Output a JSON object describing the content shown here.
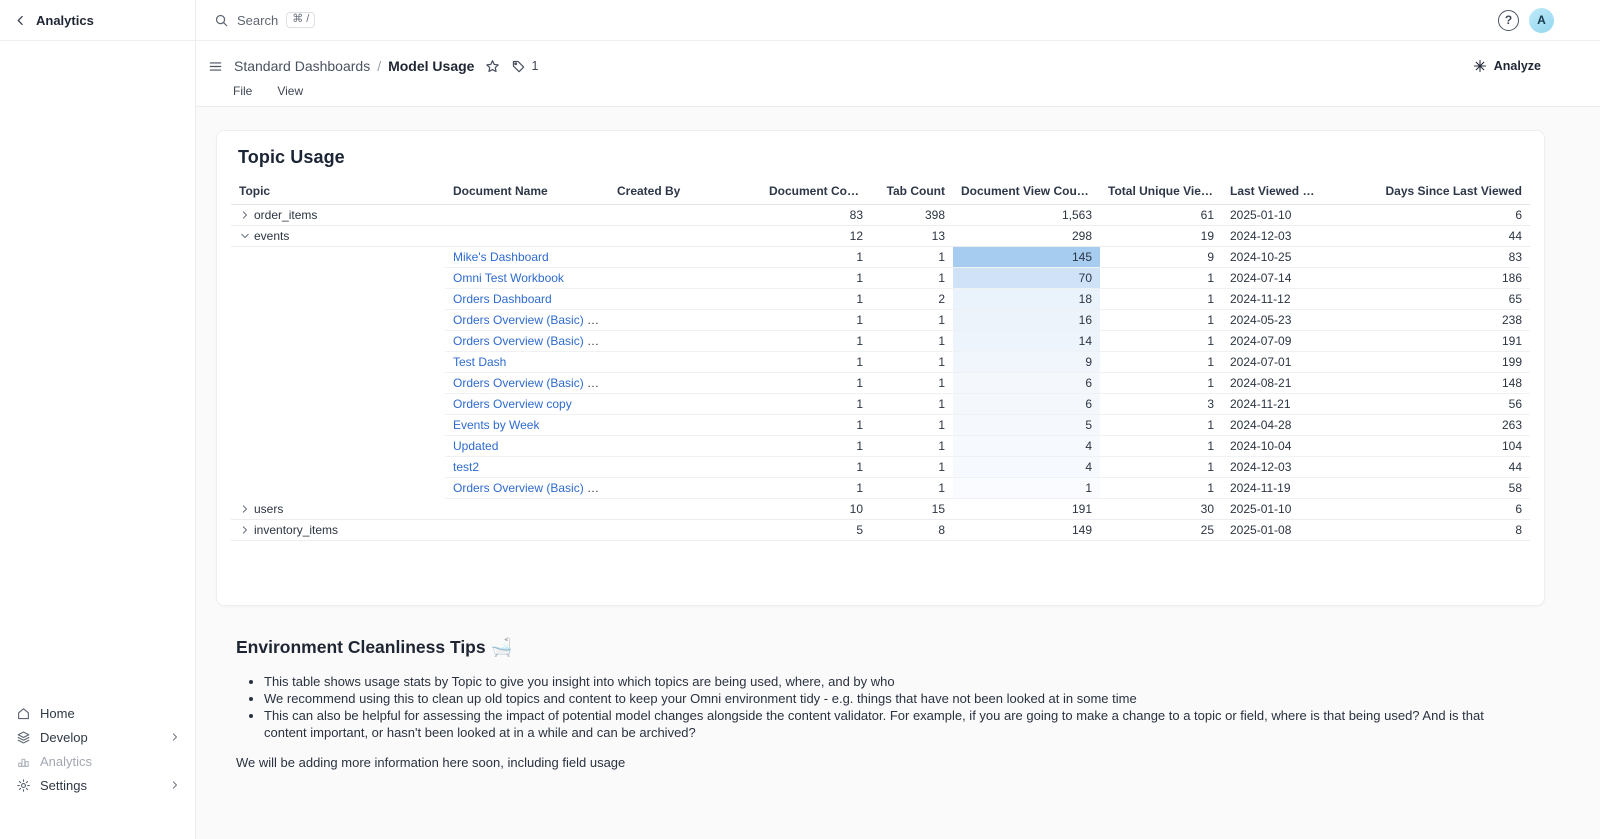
{
  "sidebar": {
    "title": "Analytics",
    "nav": [
      {
        "label": "Home",
        "icon": "home-icon",
        "chevron": false,
        "muted": false
      },
      {
        "label": "Develop",
        "icon": "layers-icon",
        "chevron": true,
        "muted": false
      },
      {
        "label": "Analytics",
        "icon": "bar-chart-icon",
        "chevron": false,
        "muted": true
      },
      {
        "label": "Settings",
        "icon": "gear-icon",
        "chevron": true,
        "muted": false
      }
    ]
  },
  "topbar": {
    "search_label": "Search",
    "search_shortcut": "⌘ /",
    "avatar_initial": "A",
    "help_glyph": "?"
  },
  "doc_header": {
    "breadcrumb_parent": "Standard Dashboards",
    "breadcrumb_separator": "/",
    "breadcrumb_current": "Model Usage",
    "tag_count": "1",
    "menus": [
      "File",
      "View"
    ],
    "analyze_label": "Analyze"
  },
  "table_card": {
    "title": "Topic Usage",
    "headers": [
      {
        "label": "Topic",
        "align": "left"
      },
      {
        "label": "Document Name",
        "align": "left"
      },
      {
        "label": "Created By",
        "align": "left"
      },
      {
        "label": "Document Count",
        "align": "right"
      },
      {
        "label": "Tab Count",
        "align": "right"
      },
      {
        "label": "Document View Count",
        "align": "right",
        "sort": "↓"
      },
      {
        "label": "Total Unique Viewers",
        "align": "right"
      },
      {
        "label": "Last Viewed Date",
        "align": "left"
      },
      {
        "label": "Days Since Last Viewed",
        "align": "right"
      }
    ],
    "rows": [
      {
        "type": "topic",
        "expanded": false,
        "topic": "order_items",
        "doc": "",
        "created_by": "",
        "document_count": "83",
        "tab_count": "398",
        "view_count": "1,563",
        "unique_viewers": "61",
        "last_viewed": "2025-01-10",
        "days": "6",
        "heat": ""
      },
      {
        "type": "topic",
        "expanded": true,
        "topic": "events",
        "doc": "",
        "created_by": "",
        "document_count": "12",
        "tab_count": "13",
        "view_count": "298",
        "unique_viewers": "19",
        "last_viewed": "2024-12-03",
        "days": "44",
        "heat": ""
      },
      {
        "type": "doc",
        "topic": "",
        "doc": "Mike's Dashboard",
        "created_by": "",
        "document_count": "1",
        "tab_count": "1",
        "view_count": "145",
        "unique_viewers": "9",
        "last_viewed": "2024-10-25",
        "days": "83",
        "heat": "#a6cdf0"
      },
      {
        "type": "doc",
        "topic": "",
        "doc": "Omni Test Workbook",
        "created_by": "",
        "document_count": "1",
        "tab_count": "1",
        "view_count": "70",
        "unique_viewers": "1",
        "last_viewed": "2024-07-14",
        "days": "186",
        "heat": "#cfe2f7"
      },
      {
        "type": "doc",
        "topic": "",
        "doc": "Orders Dashboard",
        "created_by": "",
        "document_count": "1",
        "tab_count": "2",
        "view_count": "18",
        "unique_viewers": "1",
        "last_viewed": "2024-11-12",
        "days": "65",
        "heat": "#eaf2fb"
      },
      {
        "type": "doc",
        "topic": "",
        "doc": "Orders Overview (Basic) copy",
        "created_by": "",
        "document_count": "1",
        "tab_count": "1",
        "view_count": "16",
        "unique_viewers": "1",
        "last_viewed": "2024-05-23",
        "days": "238",
        "heat": "#ecf3fb"
      },
      {
        "type": "doc",
        "topic": "",
        "doc": "Orders Overview (Basic) copy",
        "created_by": "",
        "document_count": "1",
        "tab_count": "1",
        "view_count": "14",
        "unique_viewers": "1",
        "last_viewed": "2024-07-09",
        "days": "191",
        "heat": "#edf4fc"
      },
      {
        "type": "doc",
        "topic": "",
        "doc": "Test Dash",
        "created_by": "",
        "document_count": "1",
        "tab_count": "1",
        "view_count": "9",
        "unique_viewers": "1",
        "last_viewed": "2024-07-01",
        "days": "199",
        "heat": "#f1f6fd"
      },
      {
        "type": "doc",
        "topic": "",
        "doc": "Orders Overview (Basic) copy",
        "created_by": "",
        "document_count": "1",
        "tab_count": "1",
        "view_count": "6",
        "unique_viewers": "1",
        "last_viewed": "2024-08-21",
        "days": "148",
        "heat": "#f4f8fd"
      },
      {
        "type": "doc",
        "topic": "",
        "doc": "Orders Overview copy",
        "created_by": "",
        "document_count": "1",
        "tab_count": "1",
        "view_count": "6",
        "unique_viewers": "3",
        "last_viewed": "2024-11-21",
        "days": "56",
        "heat": "#f4f8fd"
      },
      {
        "type": "doc",
        "topic": "",
        "doc": "Events by Week",
        "created_by": "",
        "document_count": "1",
        "tab_count": "1",
        "view_count": "5",
        "unique_viewers": "1",
        "last_viewed": "2024-04-28",
        "days": "263",
        "heat": "#f5f8fd"
      },
      {
        "type": "doc",
        "topic": "",
        "doc": "Updated",
        "created_by": "",
        "document_count": "1",
        "tab_count": "1",
        "view_count": "4",
        "unique_viewers": "1",
        "last_viewed": "2024-10-04",
        "days": "104",
        "heat": "#f6f9fe"
      },
      {
        "type": "doc",
        "topic": "",
        "doc": "test2",
        "created_by": "",
        "document_count": "1",
        "tab_count": "1",
        "view_count": "4",
        "unique_viewers": "1",
        "last_viewed": "2024-12-03",
        "days": "44",
        "heat": "#f6f9fe"
      },
      {
        "type": "doc",
        "topic": "",
        "doc": "Orders Overview (Basic) copy",
        "created_by": "",
        "document_count": "1",
        "tab_count": "1",
        "view_count": "1",
        "unique_viewers": "1",
        "last_viewed": "2024-11-19",
        "days": "58",
        "heat": "#fafbfe"
      },
      {
        "type": "topic",
        "expanded": false,
        "topic": "users",
        "doc": "",
        "created_by": "",
        "document_count": "10",
        "tab_count": "15",
        "view_count": "191",
        "unique_viewers": "30",
        "last_viewed": "2025-01-10",
        "days": "6",
        "heat": ""
      },
      {
        "type": "topic",
        "expanded": false,
        "topic": "inventory_items",
        "doc": "",
        "created_by": "",
        "document_count": "5",
        "tab_count": "8",
        "view_count": "149",
        "unique_viewers": "25",
        "last_viewed": "2025-01-08",
        "days": "8",
        "heat": ""
      }
    ]
  },
  "tips": {
    "heading": "Environment Cleanliness Tips 🛁",
    "bullets": [
      "This table shows usage stats by Topic to give you insight into which topics are being used, where, and by who",
      "We recommend using this to clean up old topics and content to keep your Omni environment tidy - e.g. things that have not been looked at in some time",
      "This can also be helpful for assessing the impact of potential model changes alongside the content validator. For example, if you are going to make a change to a topic or field, where is that being used? And is that content important, or hasn't been looked at in a while and can be archived?"
    ],
    "footer": "We will be adding more information here soon, including field usage"
  },
  "colors": {
    "link": "#2e6bce",
    "heat_max": "#a6cdf0",
    "avatar_bg": "#a9e1f4",
    "canvas_bg": "#fafafa"
  }
}
